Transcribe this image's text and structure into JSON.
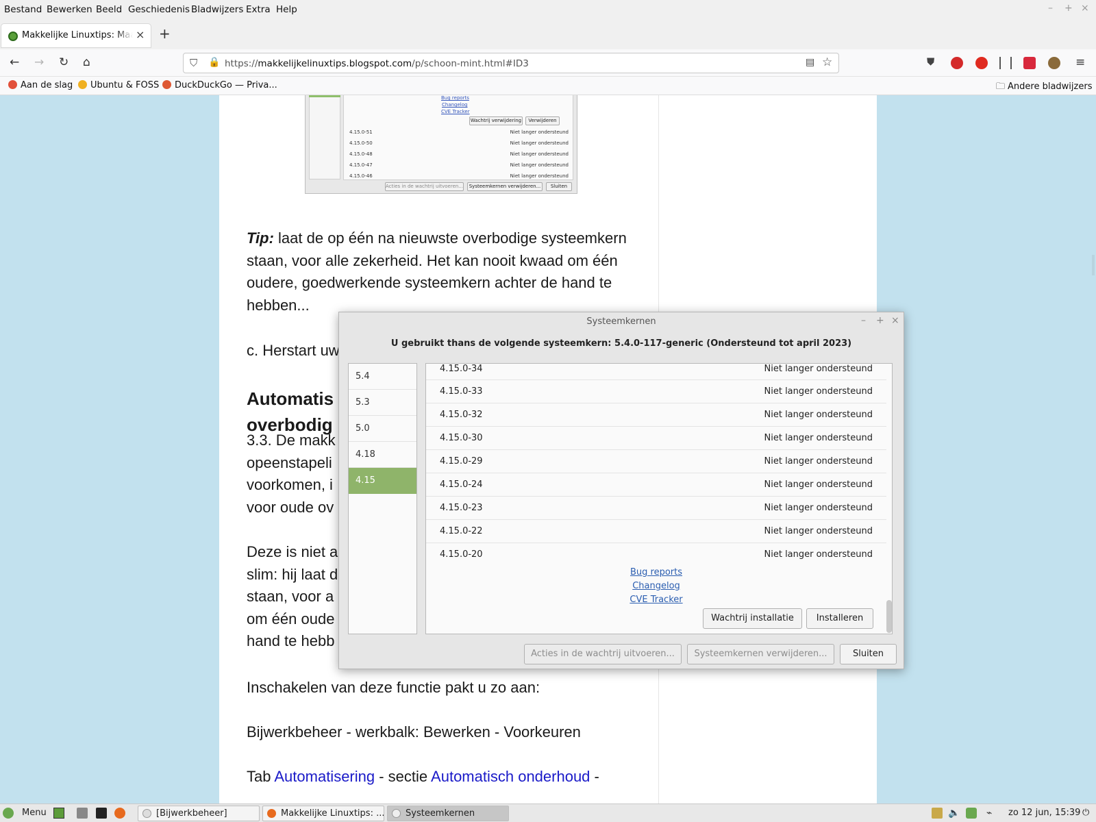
{
  "firefox": {
    "menu": [
      "Bestand",
      "Bewerken",
      "Beeld",
      "Geschiedenis",
      "Bladwijzers",
      "Extra",
      "Help"
    ],
    "tab": {
      "title": "Makkelijke Linuxtips: Maak L",
      "close": "×"
    },
    "new_tab": "+",
    "url": {
      "prefix": "https://",
      "host": "makkelijkelinuxtips.blogspot.com",
      "path": "/p/schoon-mint.html#ID3"
    },
    "bookmarks": [
      "Aan de slag",
      "Ubuntu & FOSS",
      "DuckDuckGo — Priva..."
    ],
    "other_bookmarks": "Andere bladwijzers"
  },
  "article": {
    "shot": {
      "links": [
        "Bug reports",
        "Changelog",
        "CVE Tracker"
      ],
      "buttons": [
        "Wachtrij verwijdering",
        "Verwijderen"
      ],
      "rows": [
        {
          "v": "4.15.0-51",
          "s": "Niet langer ondersteund"
        },
        {
          "v": "4.15.0-50",
          "s": "Niet langer ondersteund"
        },
        {
          "v": "4.15.0-48",
          "s": "Niet langer ondersteund"
        },
        {
          "v": "4.15.0-47",
          "s": "Niet langer ondersteund"
        },
        {
          "v": "4.15.0-46",
          "s": "Niet langer ondersteund"
        }
      ],
      "footer": [
        "Acties in de wachtrij uitvoeren...",
        "Systeemkernen verwijderen...",
        "Sluiten"
      ]
    },
    "tip_label": "Tip:",
    "tip_text": " laat de op één na nieuwste overbodige systeemkern staan, voor alle zekerheid. Het kan nooit kwaad om één oudere, goedwerkende systeemkern achter de hand te hebben...",
    "step_c": "c. Herstart uw",
    "heading": "Automatis overbodig",
    "p33": "3.3. De makk opeenstapeli voorkomen, i voor oude ov",
    "p_deze": "Deze is niet a slim: hij laat d staan, voor a om één oude hand te hebb",
    "p_inschakelen": "Inschakelen van deze functie pakt u zo aan:",
    "p_bijwerk": "Bijwerkbeheer - werkbalk: Bewerken - Voorkeuren",
    "p_tab": {
      "a": "Tab ",
      "l1": "Automatisering",
      "b": " - sectie ",
      "l2": "Automatisch onderhoud",
      "c": " -"
    }
  },
  "dialog": {
    "title": "Systeemkernen",
    "info": "U gebruikt thans de volgende systeemkern: 5.4.0-117-generic (Ondersteund tot april 2023)",
    "versions": [
      "5.4",
      "5.3",
      "5.0",
      "4.18",
      "4.15"
    ],
    "selected_version": "4.15",
    "kernels": [
      {
        "v": "4.15.0-34",
        "s": "Niet langer ondersteund"
      },
      {
        "v": "4.15.0-33",
        "s": "Niet langer ondersteund"
      },
      {
        "v": "4.15.0-32",
        "s": "Niet langer ondersteund"
      },
      {
        "v": "4.15.0-30",
        "s": "Niet langer ondersteund"
      },
      {
        "v": "4.15.0-29",
        "s": "Niet langer ondersteund"
      },
      {
        "v": "4.15.0-24",
        "s": "Niet langer ondersteund"
      },
      {
        "v": "4.15.0-23",
        "s": "Niet langer ondersteund"
      },
      {
        "v": "4.15.0-22",
        "s": "Niet langer ondersteund"
      },
      {
        "v": "4.15.0-20",
        "s": "Niet langer ondersteund"
      }
    ],
    "links": {
      "bug": "Bug reports",
      "changelog": "Changelog",
      "cve": "CVE Tracker"
    },
    "queue_install": "Wachtrij installatie",
    "install": "Installeren",
    "run_queue": "Acties in de wachtrij uitvoeren...",
    "remove_kernels": "Systeemkernen verwijderen...",
    "close": "Sluiten"
  },
  "panel": {
    "menu": "Menu",
    "tasks": [
      "[Bijwerkbeheer]",
      "Makkelijke Linuxtips: ...",
      "Systeemkernen"
    ],
    "clock": "zo 12 jun, 15:39"
  },
  "colors": {
    "selected": "#8fb46a",
    "link": "#2a5db0",
    "page_bg": "#c2e1ee"
  }
}
